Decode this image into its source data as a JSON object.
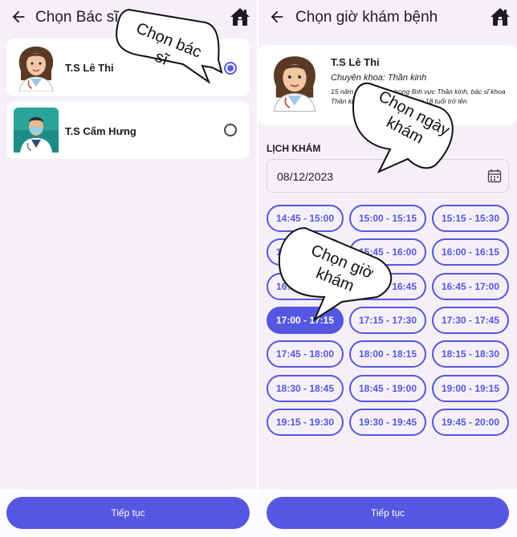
{
  "left": {
    "title": "Chọn Bác sĩ",
    "doctors": [
      {
        "name": "T.S Lê Thi",
        "selected": true
      },
      {
        "name": "T.S Cẩm Hưng",
        "selected": false
      }
    ],
    "continue_label": "Tiếp tục",
    "callout": "Chọn bác sĩ"
  },
  "right": {
    "title": "Chọn giờ khám bệnh",
    "doctor": {
      "name": "T.S Lê Thi",
      "specialty": "Chuyên khoa: Thần kinh",
      "bio": "15 năm kinh nghiệm trong lĩnh vực Thần kinh, bác sĩ khoa Thần kinh, khám bệnh nhân từ 18 tuổi trở lên"
    },
    "schedule_label": "LỊCH KHÁM",
    "date_value": "08/12/2023",
    "slots": [
      "14:45 - 15:00",
      "15:00 - 15:15",
      "15:15 - 15:30",
      "15:30 - 15:45",
      "15:45 - 16:00",
      "16:00 - 16:15",
      "16:15 - 16:30",
      "16:30 - 16:45",
      "16:45 - 17:00",
      "17:00 - 17:15",
      "17:15 - 17:30",
      "17:30 - 17:45",
      "17:45 - 18:00",
      "18:00 - 18:15",
      "18:15 - 18:30",
      "18:30 - 18:45",
      "18:45 - 19:00",
      "19:00 - 19:15",
      "19:15 - 19:30",
      "19:30 - 19:45",
      "19:45 - 20:00"
    ],
    "selected_slot": "17:00 - 17:15",
    "continue_label": "Tiếp tục",
    "callout_date": "Chọn ngày khám",
    "callout_time": "Chọn giờ khám"
  },
  "colors": {
    "accent": "#5557e0",
    "background": "#f5f0f7"
  },
  "icons": [
    "back-arrow-icon",
    "home-icon",
    "calendar-icon",
    "radio-icon"
  ]
}
